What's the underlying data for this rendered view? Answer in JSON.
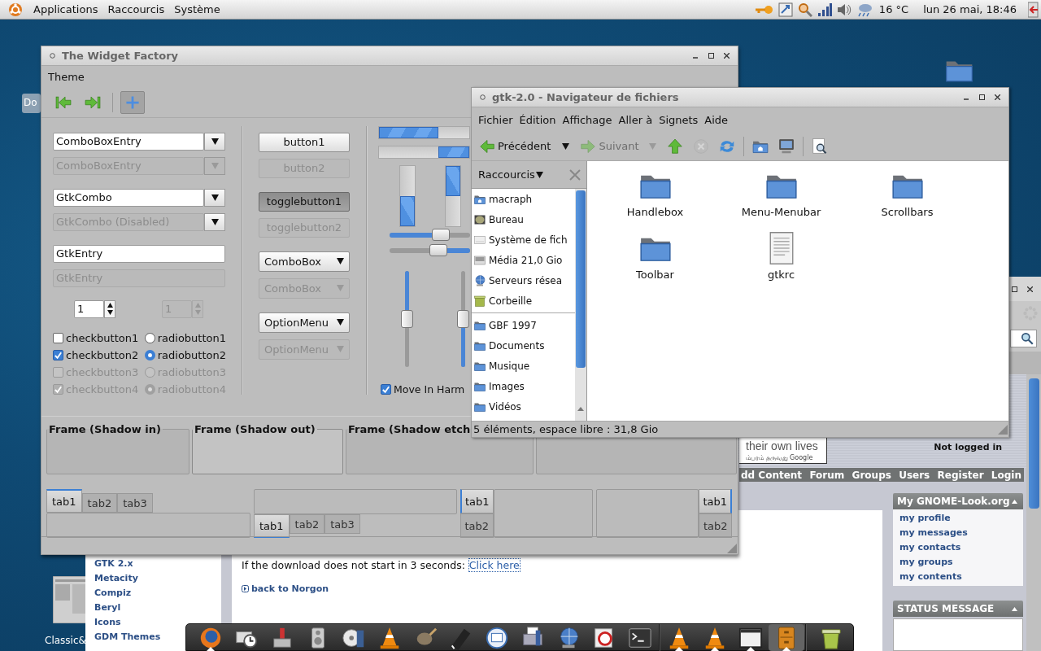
{
  "top_panel": {
    "menus": [
      "Applications",
      "Raccourcis",
      "Système"
    ],
    "temperature": "16 °C",
    "clock": "lun 26 mai, 18:46"
  },
  "desktop_icons": [
    {
      "kind": "folder"
    },
    {
      "kind": "label",
      "label": "Do"
    },
    {
      "kind": "thumbnail",
      "label": "Classic&"
    }
  ],
  "browser": {
    "ad_text": "their own lives",
    "ad_credit": "ம்பரம் தருவது Google",
    "login_status": "Not logged in",
    "nav": [
      "dd Content",
      "Forum",
      "Groups",
      "Users",
      "Register",
      "Login"
    ],
    "sidebar_links": [
      "GTK 2.x",
      "Metacity",
      "Compiz",
      "Beryl",
      "Icons",
      "GDM Themes"
    ],
    "download_text": "If the download does not start in 3 seconds:",
    "download_link": "Click here",
    "back_link": "back to Norgon",
    "boxes": [
      {
        "title": "My GNOME-Look.org",
        "links": [
          "my profile",
          "my messages",
          "my contacts",
          "my groups",
          "my contents"
        ]
      },
      {
        "title": "STATUS MESSAGE"
      }
    ]
  },
  "widget_factory": {
    "title": "The Widget Factory",
    "menu": [
      "Theme"
    ],
    "toolbar": [
      {
        "kind": "first",
        "selected": false
      },
      {
        "kind": "last",
        "selected": false
      },
      {
        "kind": "add",
        "selected": true
      }
    ],
    "entries": [
      {
        "kind": "combo_entry",
        "value": "ComboBoxEntry",
        "disabled": false
      },
      {
        "kind": "combo_entry",
        "value": "ComboBoxEntry",
        "disabled": true
      },
      {
        "kind": "combo",
        "value": "GtkCombo",
        "disabled": false
      },
      {
        "kind": "combo",
        "value": "GtkCombo (Disabled)",
        "disabled": true
      },
      {
        "kind": "entry",
        "value": "GtkEntry",
        "disabled": false
      },
      {
        "kind": "entry",
        "value": "GtkEntry",
        "disabled": true
      }
    ],
    "spins": [
      {
        "value": "1",
        "disabled": false
      },
      {
        "value": "1",
        "disabled": true
      }
    ],
    "checks": [
      {
        "label": "checkbutton1",
        "checked": false,
        "disabled": false
      },
      {
        "label": "checkbutton2",
        "checked": true,
        "disabled": false
      },
      {
        "label": "checkbutton3",
        "checked": false,
        "disabled": true
      },
      {
        "label": "checkbutton4",
        "checked": true,
        "disabled": true
      }
    ],
    "radios": [
      {
        "label": "radiobutton1",
        "selected": false,
        "disabled": false
      },
      {
        "label": "radiobutton2",
        "selected": true,
        "disabled": false
      },
      {
        "label": "radiobutton3",
        "selected": false,
        "disabled": true
      },
      {
        "label": "radiobutton4",
        "selected": true,
        "disabled": true
      }
    ],
    "buttons": [
      {
        "kind": "button",
        "label": "button1",
        "on": false,
        "disabled": false
      },
      {
        "kind": "button",
        "label": "button2",
        "on": false,
        "disabled": true
      },
      {
        "kind": "toggle",
        "label": "togglebutton1",
        "on": true,
        "disabled": false
      },
      {
        "kind": "toggle",
        "label": "togglebutton2",
        "on": false,
        "disabled": true
      },
      {
        "kind": "dropdown",
        "label": "ComboBox",
        "on": false,
        "disabled": false
      },
      {
        "kind": "dropdown",
        "label": "ComboBox",
        "on": false,
        "disabled": true
      },
      {
        "kind": "dropdown",
        "label": "OptionMenu",
        "on": false,
        "disabled": false
      },
      {
        "kind": "dropdown",
        "label": "OptionMenu",
        "on": false,
        "disabled": true
      }
    ],
    "progress_bars": [
      {
        "level": 0.66,
        "inverted": false
      },
      {
        "level": 0.34,
        "inverted": true
      }
    ],
    "vertical_progress": [
      {
        "level": 0.5,
        "inverted": false
      },
      {
        "level": 0.5,
        "inverted": true
      }
    ],
    "scales": [
      {
        "level": 0.64,
        "inverted": false
      },
      {
        "level": 0.61,
        "inverted": true
      }
    ],
    "vertical_scales": [
      {
        "level": 0.5,
        "inverted": false
      },
      {
        "level": 0.5,
        "inverted": true
      }
    ],
    "harmony": {
      "label": "Move In Harm",
      "checked": true
    },
    "frames": [
      {
        "label": "Frame (Shadow in)",
        "kind": "in"
      },
      {
        "label": "Frame (Shadow out)",
        "kind": "out"
      },
      {
        "label": "Frame (Shadow etch",
        "kind": "etched"
      },
      {
        "kind": "etched"
      }
    ],
    "notebooks": [
      {
        "kind": "top",
        "tabs": [
          {
            "label": "tab1",
            "selected": true
          },
          {
            "label": "tab2",
            "selected": false
          },
          {
            "label": "tab3",
            "selected": false
          }
        ]
      },
      {
        "kind": "bottom",
        "tabs": [
          {
            "label": "tab1",
            "selected": true
          },
          {
            "label": "tab2",
            "selected": false
          },
          {
            "label": "tab3",
            "selected": false
          }
        ]
      },
      {
        "kind": "left",
        "tabs": [
          {
            "label": "tab1",
            "selected": true
          },
          {
            "label": "tab2",
            "selected": false
          }
        ]
      },
      {
        "kind": "right",
        "tabs": [
          {
            "label": "tab1",
            "selected": true
          },
          {
            "label": "tab2",
            "selected": false
          }
        ]
      }
    ]
  },
  "file_manager": {
    "title": "gtk-2.0 - Navigateur de fichiers",
    "menu": [
      "Fichier",
      "Édition",
      "Affichage",
      "Aller à",
      "Signets",
      "Aide"
    ],
    "toolbar": [
      {
        "kind": "back",
        "label": "Précédent",
        "disabled": false
      },
      {
        "kind": "history",
        "disabled": false
      },
      {
        "kind": "forward",
        "label": "Suivant",
        "disabled": true
      },
      {
        "kind": "history",
        "disabled": true
      },
      {
        "kind": "up",
        "disabled": false
      },
      {
        "kind": "stop",
        "disabled": true
      },
      {
        "kind": "reload",
        "disabled": false
      },
      {
        "kind": "separator"
      },
      {
        "kind": "home",
        "disabled": false
      },
      {
        "kind": "computer",
        "disabled": false
      },
      {
        "kind": "separator"
      },
      {
        "kind": "zoom",
        "disabled": false
      }
    ],
    "sidebar": {
      "title": "Raccourcis",
      "places": [
        {
          "kind": "home",
          "label": "macraph"
        },
        {
          "kind": "desktop",
          "label": "Bureau"
        },
        {
          "kind": "drive",
          "label": "Système de fich"
        },
        {
          "kind": "media",
          "label": "Média 21,0 Gio"
        },
        {
          "kind": "network",
          "label": "Serveurs résea"
        },
        {
          "kind": "trash",
          "label": "Corbeille"
        }
      ],
      "bookmarks": [
        {
          "label": "GBF 1997"
        },
        {
          "label": "Documents"
        },
        {
          "label": "Musique"
        },
        {
          "label": "Images"
        },
        {
          "label": "Vidéos"
        }
      ]
    },
    "files": [
      {
        "kind": "folder",
        "name": "Handlebox"
      },
      {
        "kind": "folder",
        "name": "Menu-Menubar"
      },
      {
        "kind": "folder",
        "name": "Scrollbars"
      },
      {
        "kind": "folder",
        "name": "Toolbar"
      },
      {
        "kind": "document",
        "name": "gtkrc"
      }
    ],
    "status": "5 éléments, espace libre : 31,8 Gio"
  },
  "dock": [
    {
      "kind": "globe",
      "running": true,
      "selected": false
    },
    {
      "kind": "clock",
      "running": false,
      "selected": false
    },
    {
      "kind": "stamp",
      "running": false,
      "selected": false
    },
    {
      "kind": "speaker",
      "running": false,
      "selected": false
    },
    {
      "kind": "disc_speaker",
      "running": false,
      "selected": false
    },
    {
      "kind": "cone",
      "running": false,
      "selected": false
    },
    {
      "kind": "brush",
      "running": false,
      "selected": false
    },
    {
      "kind": "pen",
      "running": false,
      "selected": false
    },
    {
      "kind": "mail",
      "running": false,
      "selected": false
    },
    {
      "kind": "printer",
      "running": false,
      "selected": false
    },
    {
      "kind": "network",
      "running": false,
      "selected": false
    },
    {
      "kind": "disc",
      "running": false,
      "selected": false
    },
    {
      "kind": "terminal",
      "running": false,
      "selected": false
    },
    {
      "kind": "separator"
    },
    {
      "kind": "cone",
      "running": true,
      "selected": false
    },
    {
      "kind": "cone",
      "running": true,
      "selected": false
    },
    {
      "kind": "window",
      "running": true,
      "selected": false
    },
    {
      "kind": "cabinet",
      "running": true,
      "selected": true
    },
    {
      "kind": "separator"
    },
    {
      "kind": "trash",
      "running": false,
      "selected": false
    }
  ]
}
